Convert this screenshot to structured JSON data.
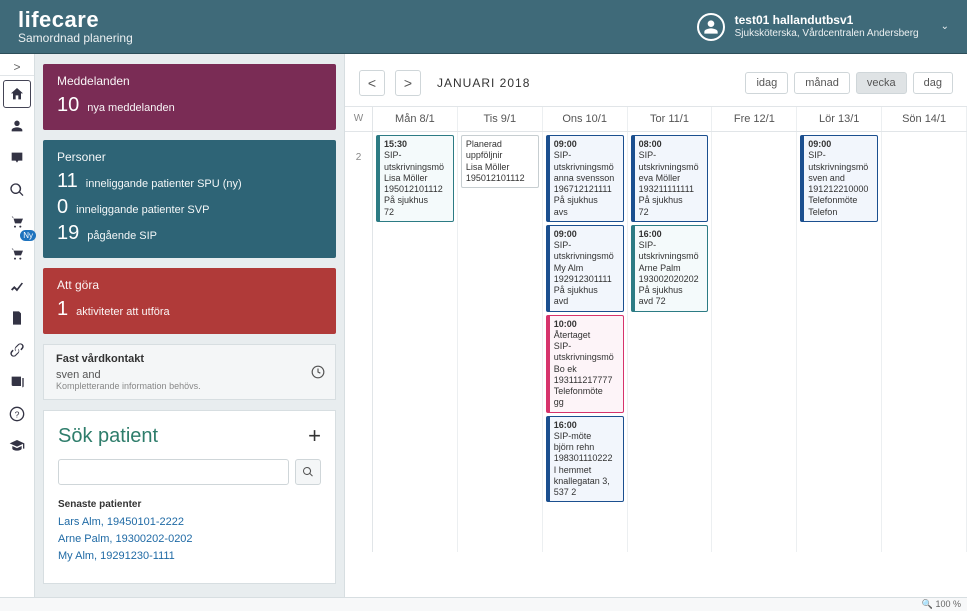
{
  "header": {
    "brand": "lifecare",
    "subtitle": "Samordnad planering",
    "user_name": "test01 hallandutbsv1",
    "user_role": "Sjuksköterska, Vårdcentralen Andersberg"
  },
  "iconbar": {
    "ny_badge": "Ny"
  },
  "dashboard": {
    "meddelanden": {
      "title": "Meddelanden",
      "count": "10",
      "label": "nya meddelanden"
    },
    "personer": {
      "title": "Personer",
      "lines": [
        {
          "count": "11",
          "label": "inneliggande patienter SPU (ny)"
        },
        {
          "count": "0",
          "label": "inneliggande patienter SVP"
        },
        {
          "count": "19",
          "label": "pågående SIP"
        }
      ]
    },
    "attgora": {
      "title": "Att göra",
      "count": "1",
      "label": "aktiviteter att utföra"
    },
    "fast": {
      "title": "Fast vårdkontakt",
      "name": "sven and",
      "note": "Kompletterande information behövs."
    },
    "search": {
      "title": "Sök patient",
      "placeholder": "",
      "senaste_title": "Senaste patienter",
      "patients": [
        "Lars Alm, 19450101-2222",
        "Arne Palm, 19300202-0202",
        "My Alm, 19291230-1111"
      ]
    }
  },
  "calendar": {
    "month_label": "JANUARI 2018",
    "views": {
      "idag": "idag",
      "manad": "månad",
      "vecka": "vecka",
      "dag": "dag",
      "active": "vecka"
    },
    "week_header": "W",
    "week_number": "2",
    "days": [
      {
        "label": "Mån 8/1"
      },
      {
        "label": "Tis 9/1"
      },
      {
        "label": "Ons 10/1"
      },
      {
        "label": "Tor 11/1"
      },
      {
        "label": "Fre 12/1"
      },
      {
        "label": "Lör 13/1"
      },
      {
        "label": "Sön 14/1"
      }
    ],
    "events": {
      "0": [
        {
          "cls": "ev-teal",
          "lines": [
            "15:30",
            "SIP-utskrivningsmö",
            "Lisa Möller",
            "195012101112",
            "På sjukhus",
            "72"
          ]
        }
      ],
      "1": [
        {
          "cls": "ev-plain",
          "lines": [
            "Planerad uppföljnir",
            "Lisa Möller",
            "195012101112"
          ]
        }
      ],
      "2": [
        {
          "cls": "ev-blue",
          "lines": [
            "09:00",
            "SIP-utskrivningsmö",
            "anna svensson",
            "196712121111",
            "På sjukhus",
            "avs"
          ]
        },
        {
          "cls": "ev-blue",
          "lines": [
            "09:00",
            "SIP-utskrivningsmö",
            "My Alm",
            "192912301111",
            "På sjukhus",
            "avd"
          ]
        },
        {
          "cls": "ev-pink",
          "lines": [
            "10:00",
            "Återtaget",
            "SIP-utskrivningsmö",
            "Bo ek",
            "193111217777",
            "Telefonmöte",
            "gg"
          ]
        },
        {
          "cls": "ev-blue",
          "lines": [
            "16:00",
            "SIP-möte",
            "björn rehn",
            "198301110222",
            "I hemmet",
            "knallegatan 3, 537 2"
          ]
        }
      ],
      "3": [
        {
          "cls": "ev-blue",
          "lines": [
            "08:00",
            "SIP-utskrivningsmö",
            "eva Möller",
            "193211111111",
            "På sjukhus",
            "72"
          ]
        },
        {
          "cls": "ev-teal",
          "lines": [
            "16:00",
            "SIP-utskrivningsmö",
            "Arne Palm",
            "193002020202",
            "På sjukhus",
            "avd 72"
          ]
        }
      ],
      "4": [],
      "5": [
        {
          "cls": "ev-blue",
          "lines": [
            "09:00",
            "SIP-utskrivningsmö",
            "sven and",
            "191212210000",
            "Telefonmöte",
            "Telefon"
          ]
        }
      ],
      "6": []
    }
  },
  "status": {
    "zoom": "100 %"
  }
}
